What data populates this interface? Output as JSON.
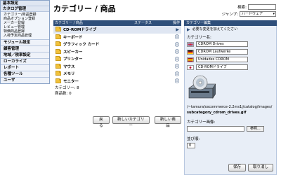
{
  "sidebar": {
    "groups": [
      {
        "title": "基本設定"
      },
      {
        "title": "カタログ管理",
        "items": [
          "カテゴリー/商品登録",
          "商品オプション登録",
          "メーカー登録",
          "レビュー管理",
          "特価商品登録",
          "入荷予定商品管理"
        ]
      }
    ],
    "items": [
      "モジュール設定",
      "顧客管理",
      "地域／税率設定",
      "ローカライズ",
      "レポート",
      "各種ツール",
      "ユーザ"
    ]
  },
  "header": {
    "title": "カテゴリー / 商品",
    "search_label": "検索:",
    "jump_label": "ジャンプ:",
    "jump_value": "ハードウェア"
  },
  "table": {
    "col_category": "カテゴリー / 商品",
    "col_status": "ステータス",
    "col_operation": "操作",
    "rows": [
      {
        "label": "CD-ROMドライブ",
        "selected": true
      },
      {
        "label": "キーボード",
        "selected": false
      },
      {
        "label": "グラフィック カード",
        "selected": false
      },
      {
        "label": "スピーカー",
        "selected": false
      },
      {
        "label": "プリンター",
        "selected": false
      },
      {
        "label": "マウス",
        "selected": false
      },
      {
        "label": "メモリ",
        "selected": false
      },
      {
        "label": "モニター",
        "selected": false
      }
    ],
    "row_op_icon": "info-icon",
    "category_count": "カテゴリー: 8",
    "product_count": "商品数: 0"
  },
  "buttons": {
    "back": "戻る",
    "new_category": "新しいカテゴリー",
    "new_product": "新しい商品"
  },
  "panel": {
    "title": "カテゴリー編集",
    "note": "必要な変更を加えてください",
    "name_label": "カテゴリー名:",
    "languages": [
      {
        "flag": "uk",
        "value": "CDROM Drives"
      },
      {
        "flag": "de",
        "value": "CDROM Laufwerke"
      },
      {
        "flag": "es",
        "value": "Unidades CDROM"
      },
      {
        "flag": "jp",
        "value": "CD-ROMドライブ"
      }
    ],
    "image_path": "/~tamura/oscommerce-2.2ms1j/catalog/images/",
    "image_file": "subcategory_cdrom_drives.gif",
    "image_label": "カテゴリー画像:",
    "browse": "参照...",
    "sort_label": "並び順:",
    "sort_value": "0",
    "save": "保存",
    "cancel": "取り消し"
  },
  "colors": {
    "header_bg": "#2f4f7a",
    "sidebar_bg": "#f1f5fb",
    "folder": "#f1c13a"
  }
}
